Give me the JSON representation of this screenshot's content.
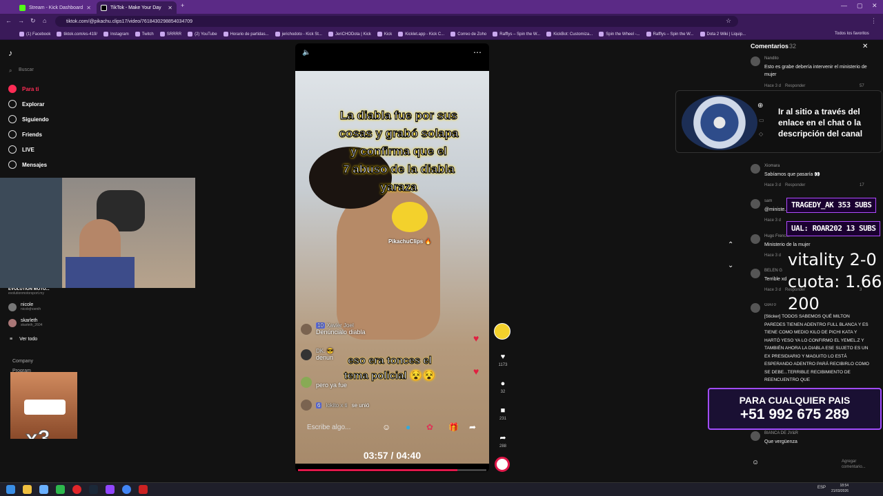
{
  "browser": {
    "tabs": [
      {
        "label": "Stream - Kick Dashboard",
        "color": "#53fc18"
      },
      {
        "label": "TikTok - Make Your Day",
        "color": "#111111"
      }
    ],
    "url": "tiktok.com/@pikachu.clips17/video/7618430298854034709",
    "bookmarks": [
      "(1) Facebook",
      "tiktok.com/es-419/",
      "Instagram",
      "Twitch",
      "SRRRR",
      "(2) YouTube",
      "Horario de partidas...",
      "jerichodoto - Kick St...",
      "JeriCHODota | Kick",
      "Kick",
      "Kicklet.app - Kick C...",
      "Correo de Zoho",
      "Rafflys – Spin the W...",
      "KickBot: Customiza...",
      "Spin the Wheel -...",
      "Rafflys – Spin the W...",
      "Dota 2 Wiki | Liquip..."
    ],
    "all_bookmarks": "Todos los favoritos"
  },
  "sidebar": {
    "search": "Buscar",
    "items": [
      {
        "label": "Para ti",
        "active": true
      },
      {
        "label": "Explorar"
      },
      {
        "label": "Siguiendo"
      },
      {
        "label": "Friends"
      },
      {
        "label": "LIVE"
      },
      {
        "label": "Mensajes",
        "badge": "13"
      }
    ],
    "following": [
      {
        "name": "EVOLUTION MOTO...",
        "handle": "evolutionmotorsport.my"
      },
      {
        "name": "nicole",
        "handle": "nicolejhoenih"
      },
      {
        "name": "skarleth",
        "handle": "skarleth_2604"
      }
    ],
    "see_all": "Ver todo",
    "company": "Company",
    "program": "Program"
  },
  "video": {
    "caption_lines": [
      "La diabla fue por sus",
      "cosas y grabó solapa",
      "y confirma que el",
      "7 abuso de la diabla",
      "yaraza"
    ],
    "watermark": "PikachuClips 🔥",
    "live_chat": [
      {
        "user": "Xavier Joel",
        "level": "10",
        "text": "Denúncialo diabla"
      },
      {
        "user": "DK. 😎",
        "text": "denun"
      },
      {
        "user": "",
        "text": "pero ya fue"
      },
      {
        "user": "lokito x ti",
        "level": "6",
        "text": "se unió"
      }
    ],
    "overlay_text_lines": [
      "eso era tonces el",
      "tema policial 😵😵"
    ],
    "input_placeholder": "Escribe algo...",
    "time": "03:57 / 04:40",
    "progress_fraction": 0.846
  },
  "actions": {
    "likes": "1173",
    "comments": "32",
    "saves": "231",
    "shares": "288"
  },
  "comments": {
    "title": "Comentarios",
    "count": "32",
    "items": [
      {
        "user": "Nandito",
        "text": "Esto es grabe debería intervenir el ministerio de mujer",
        "time": "Hace 3 d",
        "reply": "Responder",
        "likes": "57"
      },
      {
        "user": "Xiomara",
        "text": "Sabíamos que pasaría 👀",
        "time": "Hace 3 d",
        "reply": "Responder",
        "likes": "17"
      },
      {
        "user": "sam",
        "text": "@ministe...",
        "time": "Hace 3 d",
        "reply": "",
        "likes": ""
      },
      {
        "user": "Hugo Frenc...",
        "text": "Ministerio de la mujer",
        "time": "Hace 3 d",
        "reply": "",
        "likes": ""
      },
      {
        "user": "BELEN G",
        "text": "Terrible xd",
        "time": "Hace 3 d",
        "reply": "Responder",
        "likes": "3"
      },
      {
        "user": "GIAT0",
        "text": "[Sticker] TODOS SABEMOS QUÉ MILTON PAREDES TIENEN ADENTRO FULL BLANCA Y ES TIENE COMO MEDIO KILO DE PICHI KATA Y HARTÓ YESO YA LO CONFIRMO EL YEMEL.Z Y TAMBIÉN AHORA LA DIABLA ESE SUJETO ES UN EX PRESIDIARIO Y MAGUITO LO ESTÁ ESPERANDO ADENTRO PARÁ RECIBIRLO COMO SE DEBE...TERRIBLE RECIBIMIENTO DE REENCUENTRO QUE",
        "time": "",
        "reply": "",
        "likes": ""
      },
      {
        "user": "BIANCA DE JV&R",
        "text": "Que vergüenza",
        "time": "",
        "reply": "",
        "likes": ""
      }
    ],
    "add_comment": "Agregar comentario..."
  },
  "overlays": {
    "promo_text": "Ir al sitio a través del enlace en el chat o la descripción del canal",
    "subs": [
      "TRAGEDY_AK 353 SUBS",
      "UAL: ROAR202 13 SUBS"
    ],
    "bet_lines": [
      "vitality 2-0",
      "cuota: 1.66",
      "200"
    ],
    "phone_title": "PARA CUALQUIER PAIS",
    "phone_number": "+51 992 675 289",
    "meme_caption": "x3"
  },
  "taskbar": {
    "time": "18:54",
    "date": "21/03/2026",
    "lang": "ESP"
  }
}
